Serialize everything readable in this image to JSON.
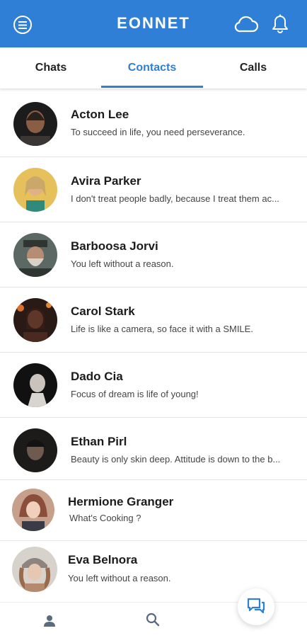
{
  "header": {
    "logo_text": "EONNET"
  },
  "tabs": [
    {
      "label": "Chats",
      "active": false
    },
    {
      "label": "Contacts",
      "active": true
    },
    {
      "label": "Calls",
      "active": false
    }
  ],
  "contacts": [
    {
      "name": "Acton Lee",
      "status": "To succeed in life, you need perseverance.",
      "avatar_color": "#3a3330"
    },
    {
      "name": "Avira Parker",
      "status": "I don't treat people badly, because I treat them ac...",
      "avatar_color": "#e2bb54"
    },
    {
      "name": "Barboosa Jorvi",
      "status": "You left without a reason.",
      "avatar_color": "#4f5a55"
    },
    {
      "name": "Carol Stark",
      "status": "Life is like a camera, so face it with a SMILE.",
      "avatar_color": "#7a3b26"
    },
    {
      "name": "Dado Cia",
      "status": "Focus of dream is life of young!",
      "avatar_color": "#2a2a2a"
    },
    {
      "name": "Ethan Pirl",
      "status": "Beauty is only skin deep. Attitude is down to the b...",
      "avatar_color": "#353230"
    },
    {
      "name": "Hermione Granger",
      "status": "What's Cooking ?",
      "avatar_color": "#b07a62"
    },
    {
      "name": "Eva Belnora",
      "status": "You left without a reason.",
      "avatar_color": "#9b8f86"
    }
  ],
  "colors": {
    "primary": "#2f7fd6"
  },
  "icons": {
    "menu": "menu-circle-icon",
    "cloud": "cloud-icon",
    "bell": "bell-icon",
    "person": "person-icon",
    "search": "search-icon",
    "chat": "chat-bubbles-icon"
  }
}
